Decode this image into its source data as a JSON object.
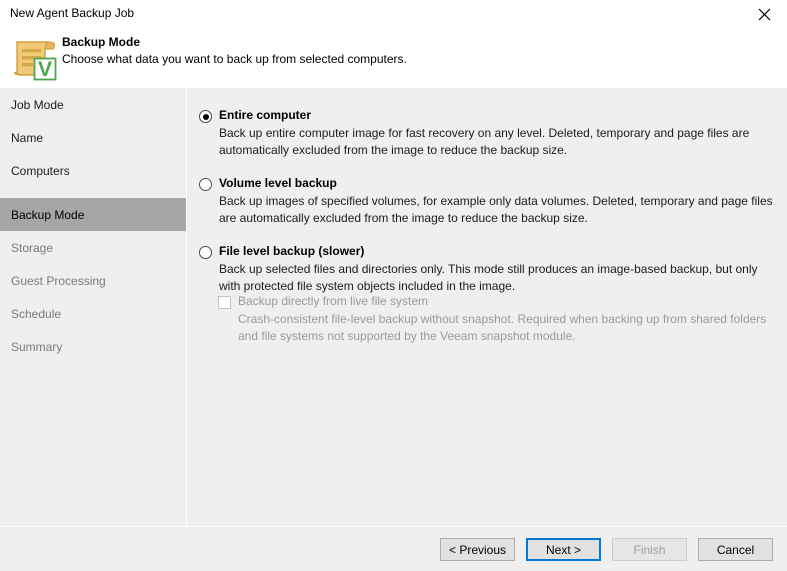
{
  "window": {
    "title": "New Agent Backup Job",
    "close_icon": "close-icon"
  },
  "header": {
    "icon": "backup-job-document-icon",
    "title": "Backup Mode",
    "subtitle": "Choose what data you want to back up from selected computers."
  },
  "sidebar": {
    "items": [
      {
        "label": "Job Mode",
        "state": "done"
      },
      {
        "label": "Name",
        "state": "done"
      },
      {
        "label": "Computers",
        "state": "done"
      },
      {
        "label": "Backup Mode",
        "state": "active"
      },
      {
        "label": "Storage",
        "state": "pending"
      },
      {
        "label": "Guest Processing",
        "state": "pending"
      },
      {
        "label": "Schedule",
        "state": "pending"
      },
      {
        "label": "Summary",
        "state": "pending"
      }
    ]
  },
  "main": {
    "options": [
      {
        "label": "Entire computer",
        "description": "Back up entire computer image for fast recovery on any level. Deleted, temporary and page files are automatically excluded from the image to reduce the backup size.",
        "selected": true
      },
      {
        "label": "Volume level backup",
        "description": "Back up images of specified volumes, for example only data volumes. Deleted, temporary and page files are automatically excluded from the image to reduce the backup size.",
        "selected": false
      },
      {
        "label": "File level backup (slower)",
        "description": "Back up selected files and directories only. This mode still produces an image-based backup, but only with protected file system objects included in the image.",
        "selected": false
      }
    ],
    "sub_option": {
      "label": "Backup directly from live file system",
      "description": "Crash-consistent file-level backup without snapshot. Required when backing up from shared folders and file systems not supported by the Veeam snapshot module.",
      "checked": false,
      "disabled": true
    }
  },
  "footer": {
    "buttons": [
      {
        "label": "< Previous",
        "state": "enabled"
      },
      {
        "label": "Next >",
        "state": "focused"
      },
      {
        "label": "Finish",
        "state": "disabled"
      },
      {
        "label": "Cancel",
        "state": "enabled"
      }
    ]
  },
  "colors": {
    "body_background": "#EFEFF0",
    "sidebar_active": "#A6A6A6",
    "focus_border": "#0078D7",
    "icon_paper": "#E8C675",
    "icon_accent": "#D6A84A",
    "badge_green": "#4CA64C"
  }
}
